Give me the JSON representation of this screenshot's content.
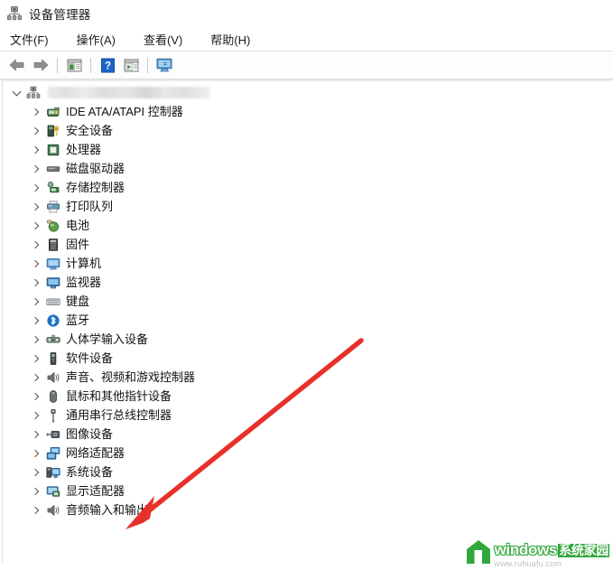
{
  "window": {
    "title": "设备管理器",
    "title_icon": "device-manager-icon"
  },
  "menubar": {
    "items": [
      {
        "label": "文件(F)",
        "name": "menu-file"
      },
      {
        "label": "操作(A)",
        "name": "menu-action"
      },
      {
        "label": "查看(V)",
        "name": "menu-view"
      },
      {
        "label": "帮助(H)",
        "name": "menu-help"
      }
    ]
  },
  "toolbar": {
    "buttons": [
      {
        "name": "back-button",
        "icon": "back-arrow-icon",
        "tooltip": "后退"
      },
      {
        "name": "forward-button",
        "icon": "forward-arrow-icon",
        "tooltip": "前进"
      },
      {
        "name": "properties-button",
        "icon": "properties-panel-icon",
        "tooltip": "属性"
      },
      {
        "name": "help-button",
        "icon": "help-question-icon",
        "tooltip": "帮助"
      },
      {
        "name": "update-driver-button",
        "icon": "scan-changes-icon",
        "tooltip": "扫描检测硬件改动"
      },
      {
        "name": "show-devices-button",
        "icon": "monitor-icon",
        "tooltip": "显示设备"
      }
    ]
  },
  "tree": {
    "root": {
      "label": "",
      "redacted": true,
      "icon": "computer-root-icon",
      "expanded": true
    },
    "items": [
      {
        "label": "IDE ATA/ATAPI 控制器",
        "icon": "ide-controller-icon"
      },
      {
        "label": "安全设备",
        "icon": "security-device-icon"
      },
      {
        "label": "处理器",
        "icon": "processor-icon"
      },
      {
        "label": "磁盘驱动器",
        "icon": "disk-drive-icon"
      },
      {
        "label": "存储控制器",
        "icon": "storage-controller-icon"
      },
      {
        "label": "打印队列",
        "icon": "print-queue-icon"
      },
      {
        "label": "电池",
        "icon": "battery-icon"
      },
      {
        "label": "固件",
        "icon": "firmware-icon"
      },
      {
        "label": "计算机",
        "icon": "computer-icon"
      },
      {
        "label": "监视器",
        "icon": "monitor-device-icon"
      },
      {
        "label": "键盘",
        "icon": "keyboard-icon"
      },
      {
        "label": "蓝牙",
        "icon": "bluetooth-icon"
      },
      {
        "label": "人体学输入设备",
        "icon": "hid-icon"
      },
      {
        "label": "软件设备",
        "icon": "software-device-icon"
      },
      {
        "label": "声音、视频和游戏控制器",
        "icon": "sound-video-game-icon"
      },
      {
        "label": "鼠标和其他指针设备",
        "icon": "mouse-icon"
      },
      {
        "label": "通用串行总线控制器",
        "icon": "usb-controller-icon"
      },
      {
        "label": "图像设备",
        "icon": "imaging-device-icon"
      },
      {
        "label": "网络适配器",
        "icon": "network-adapter-icon"
      },
      {
        "label": "系统设备",
        "icon": "system-device-icon"
      },
      {
        "label": "显示适配器",
        "icon": "display-adapter-icon"
      },
      {
        "label": "音频输入和输出",
        "icon": "audio-io-icon"
      }
    ]
  },
  "annotation": {
    "arrow_color": "#e8302a",
    "points_to": "显示适配器"
  },
  "watermark": {
    "brand_en": "windows",
    "brand_cn": "系统家园",
    "url": "www.ruhuafu.com",
    "logo_color": "#2aa636"
  }
}
